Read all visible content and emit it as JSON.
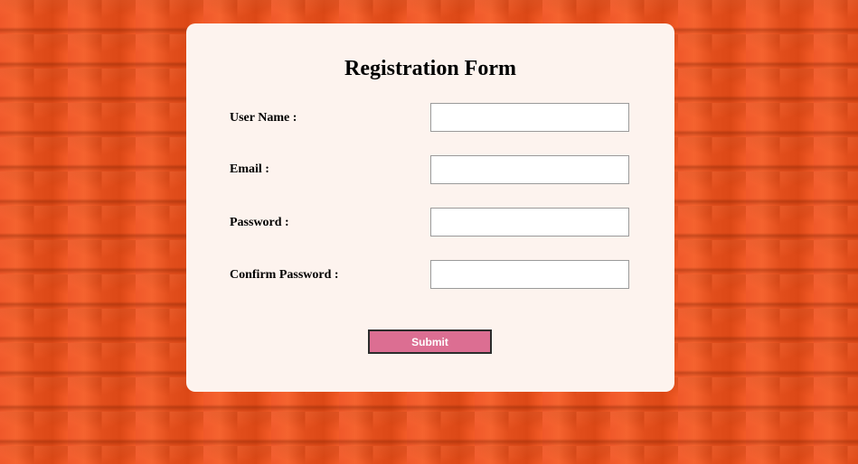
{
  "form": {
    "title": "Registration Form",
    "fields": [
      {
        "label": "User Name :",
        "value": "",
        "placeholder": ""
      },
      {
        "label": "Email :",
        "value": "",
        "placeholder": ""
      },
      {
        "label": "Password :",
        "value": "",
        "placeholder": ""
      },
      {
        "label": "Confirm Password :",
        "value": "",
        "placeholder": ""
      }
    ],
    "submit_label": "Submit"
  },
  "colors": {
    "background": "#e9521f",
    "card": "#fdf3ee",
    "submit_button": "#dc6e92"
  }
}
